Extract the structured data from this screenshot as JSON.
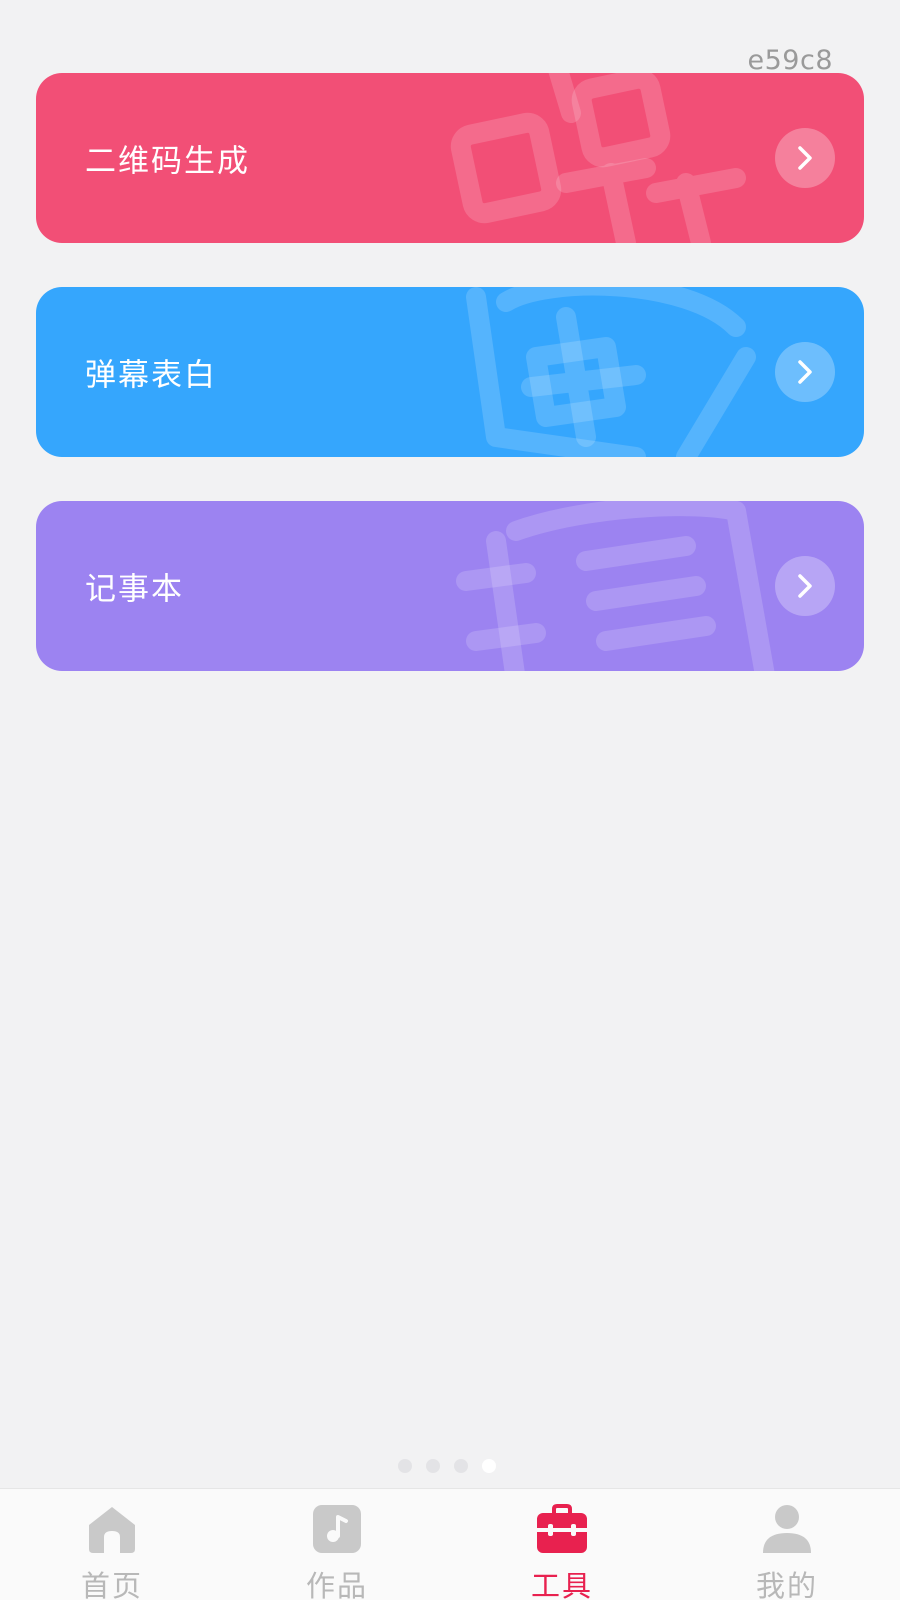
{
  "watermark": "e59c8",
  "cards": [
    {
      "label": "二维码生成",
      "color": "#f24f76",
      "icon": "qr-code-deco-icon"
    },
    {
      "label": "弹幕表白",
      "color": "#35a6fd",
      "icon": "bullet-screen-deco-icon"
    },
    {
      "label": "记事本",
      "color": "#9c83f1",
      "icon": "notebook-deco-icon"
    }
  ],
  "pager": {
    "count": 4,
    "active_index": 3
  },
  "tabbar": {
    "tabs": [
      {
        "label": "首页",
        "icon": "home-icon"
      },
      {
        "label": "作品",
        "icon": "music-works-icon"
      },
      {
        "label": "工具",
        "icon": "toolbox-icon",
        "active": true
      },
      {
        "label": "我的",
        "icon": "user-icon"
      }
    ],
    "active_color": "#e8214f",
    "inactive_color": "#b8b8b8"
  }
}
